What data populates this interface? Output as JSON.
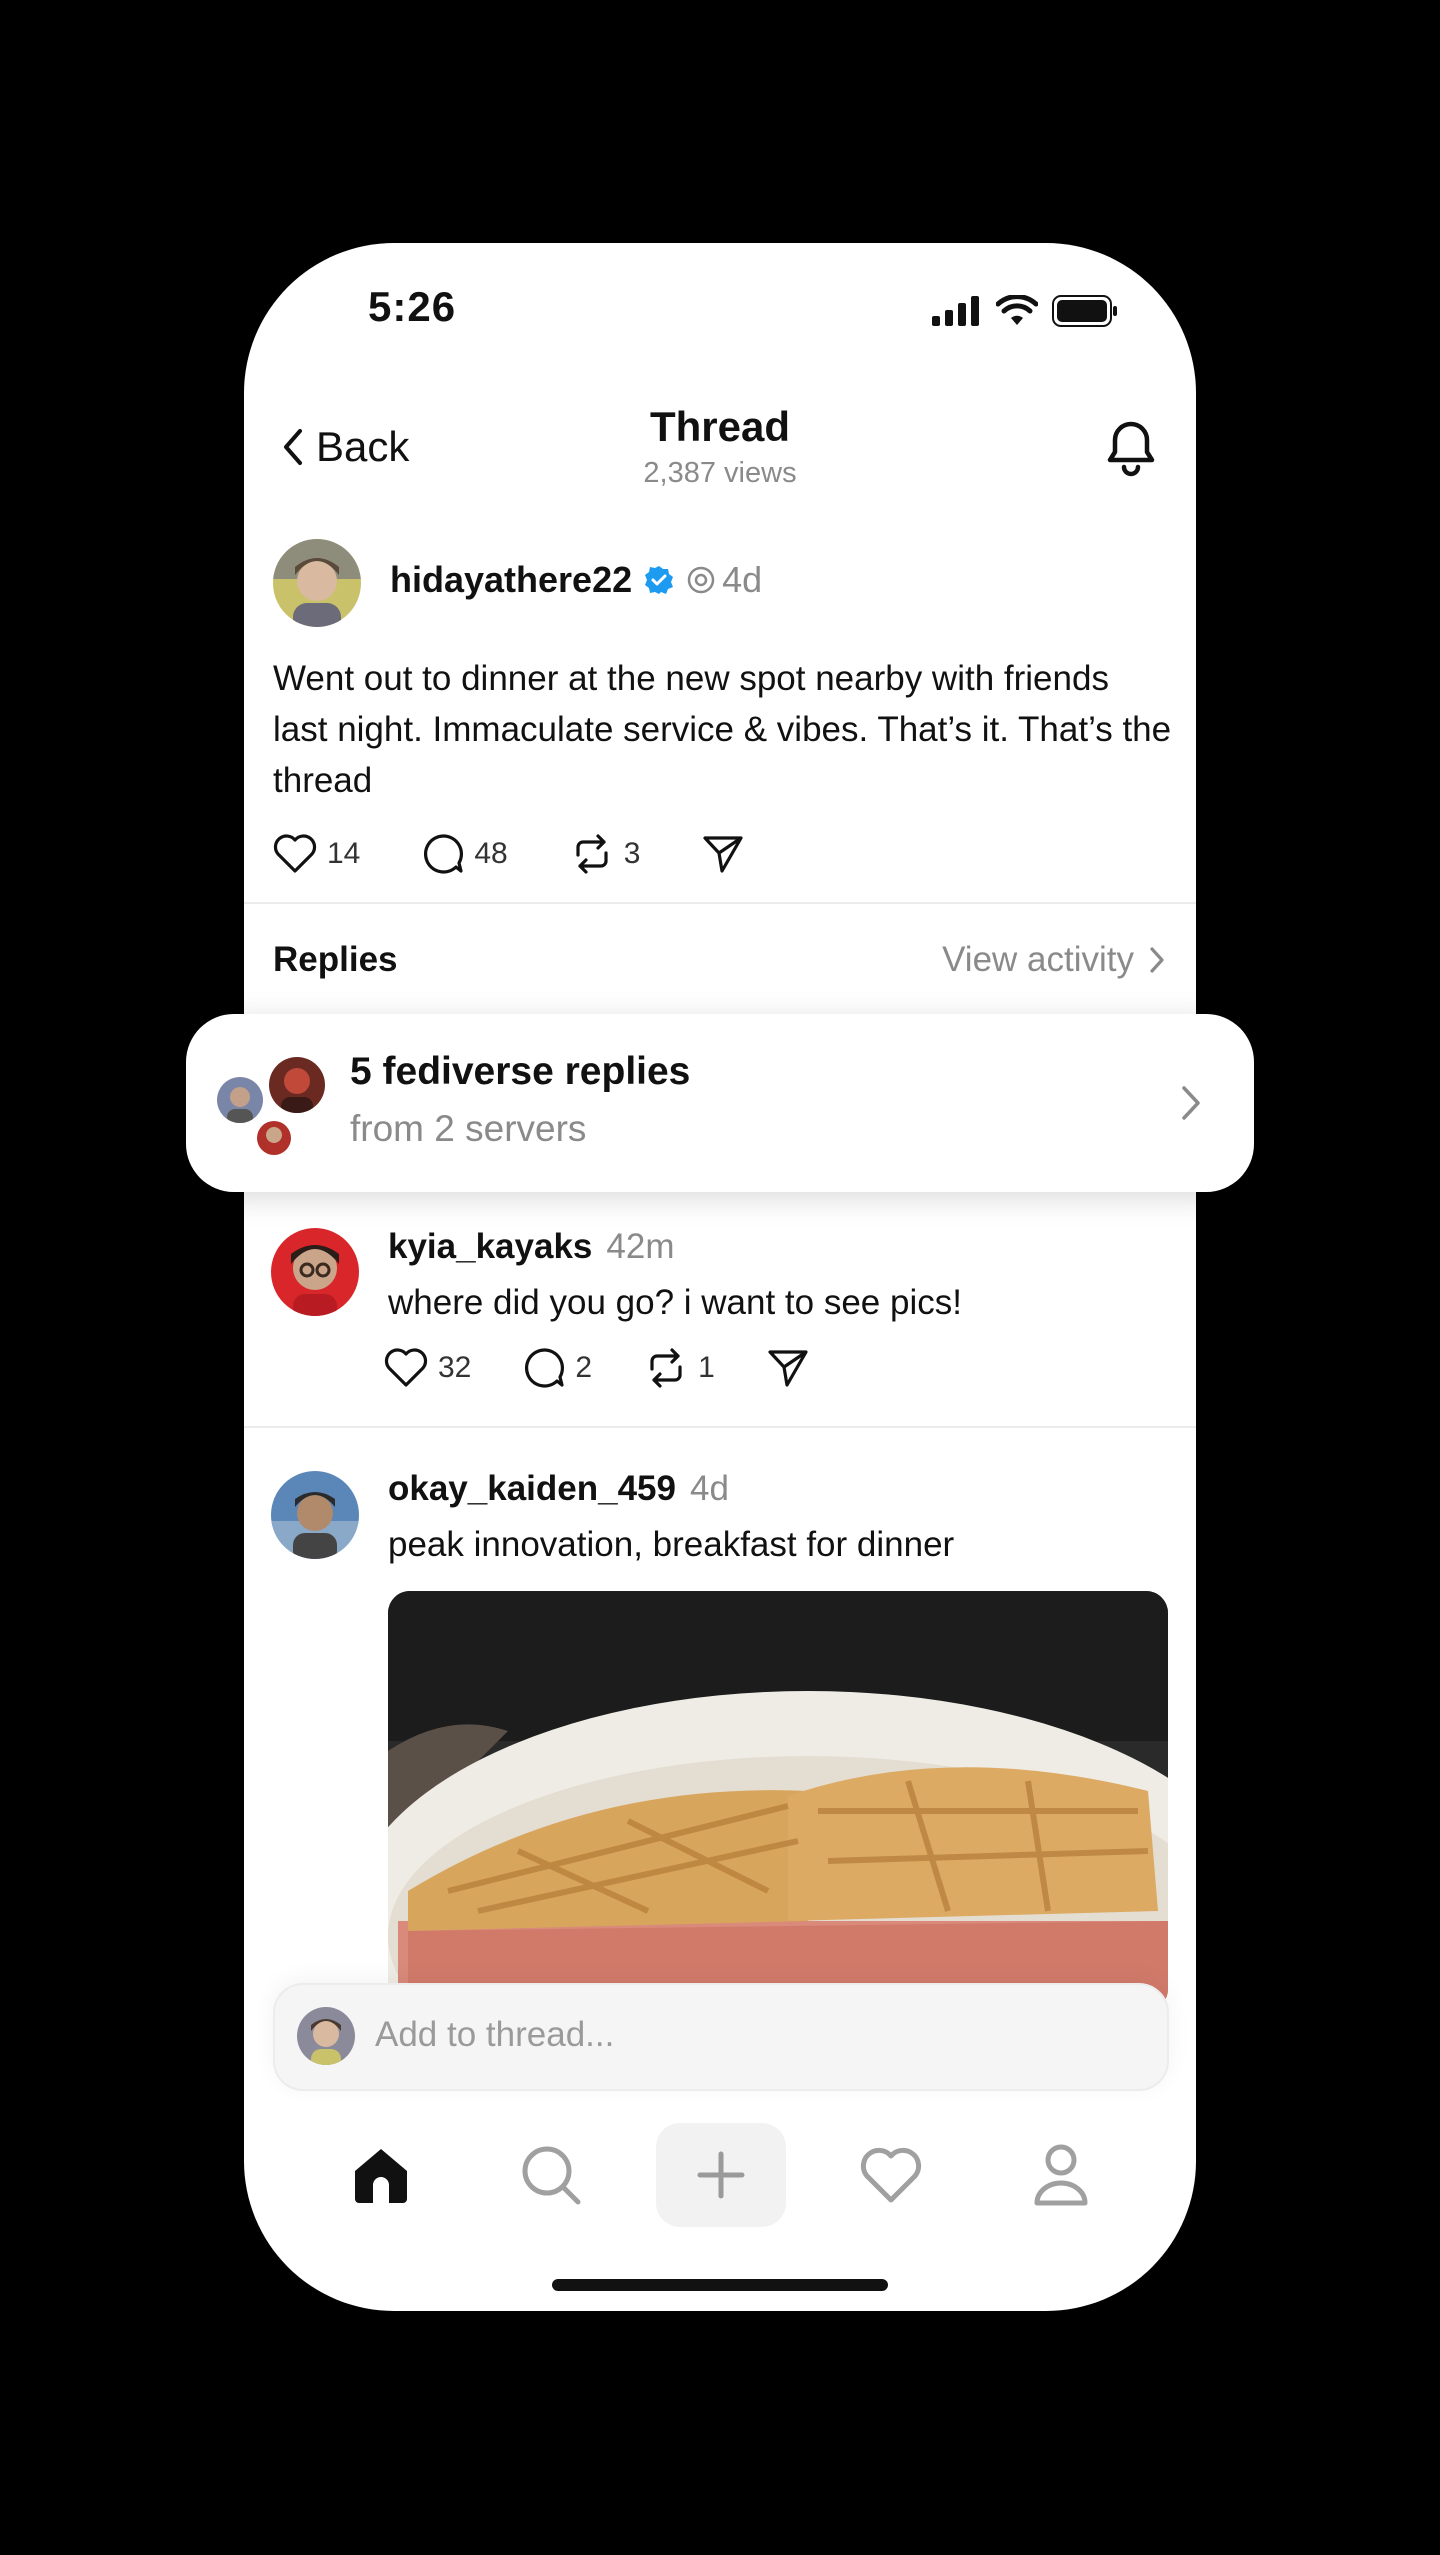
{
  "status_bar": {
    "time": "5:26"
  },
  "header": {
    "back_label": "Back",
    "title": "Thread",
    "views": "2,387 views"
  },
  "post": {
    "username": "hidayathere22",
    "age": "4d",
    "text": "Went out to dinner at the new spot nearby with friends last night. Immaculate service & vibes. That’s it. That’s the thread",
    "likes": "14",
    "comments": "48",
    "reposts": "3"
  },
  "replies_section": {
    "title": "Replies",
    "view_activity": "View activity"
  },
  "fediverse": {
    "title": "5 fediverse replies",
    "subtitle": "from 2 servers"
  },
  "replies": [
    {
      "username": "kyia_kayaks",
      "age": "42m",
      "text": "where did you go? i want to see pics!",
      "likes": "32",
      "comments": "2",
      "reposts": "1"
    },
    {
      "username": "okay_kaiden_459",
      "age": "4d",
      "text": "peak innovation, breakfast for dinner"
    }
  ],
  "composer": {
    "placeholder": "Add to thread..."
  },
  "nav": {
    "items": [
      "home-icon",
      "search-icon",
      "create-icon",
      "heart-icon",
      "profile-icon"
    ]
  },
  "colors": {
    "verified": "#1d9bf0",
    "muted": "#8a8a8a",
    "active": "#111111",
    "inactive": "#a0a0a0"
  }
}
